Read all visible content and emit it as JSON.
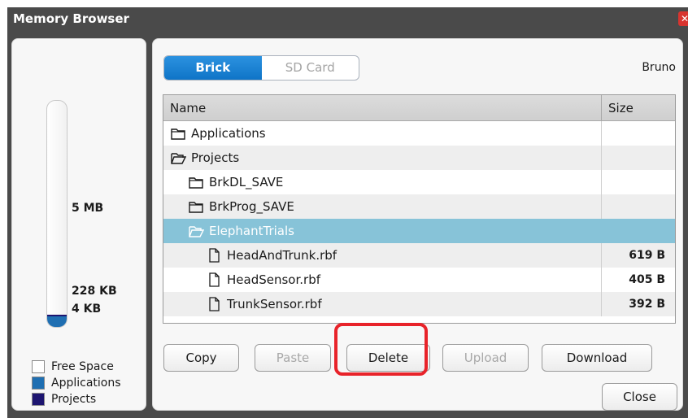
{
  "window": {
    "title": "Memory Browser"
  },
  "memory": {
    "label_total": "5 MB",
    "label_applications": "228 KB",
    "label_projects": "4 KB",
    "applications_fraction": 0.045,
    "projects_fraction": 0.001,
    "legend": [
      {
        "label": "Free Space",
        "color": "#ffffff"
      },
      {
        "label": "Applications",
        "color": "#1f6fb2"
      },
      {
        "label": "Projects",
        "color": "#1d1570"
      }
    ]
  },
  "tabs": [
    {
      "label": "Brick",
      "active": true
    },
    {
      "label": "SD Card",
      "active": false
    }
  ],
  "user": "Bruno",
  "table": {
    "headers": {
      "name": "Name",
      "size": "Size"
    },
    "rows": [
      {
        "name": "Applications",
        "size": "",
        "type": "folder-closed",
        "indent": 0,
        "selected": false
      },
      {
        "name": "Projects",
        "size": "",
        "type": "folder-open",
        "indent": 0,
        "selected": false
      },
      {
        "name": "BrkDL_SAVE",
        "size": "",
        "type": "folder-closed",
        "indent": 1,
        "selected": false
      },
      {
        "name": "BrkProg_SAVE",
        "size": "",
        "type": "folder-closed",
        "indent": 1,
        "selected": false
      },
      {
        "name": "ElephantTrials",
        "size": "",
        "type": "folder-open",
        "indent": 1,
        "selected": true
      },
      {
        "name": "HeadAndTrunk.rbf",
        "size": "619 B",
        "type": "file",
        "indent": 2,
        "selected": false
      },
      {
        "name": "HeadSensor.rbf",
        "size": "405 B",
        "type": "file",
        "indent": 2,
        "selected": false
      },
      {
        "name": "TrunkSensor.rbf",
        "size": "392 B",
        "type": "file",
        "indent": 2,
        "selected": false
      }
    ]
  },
  "buttons": {
    "copy": "Copy",
    "paste": "Paste",
    "delete": "Delete",
    "upload": "Upload",
    "download": "Download",
    "close": "Close"
  },
  "colors": {
    "accent": "#0f74c7",
    "selection": "#87c3d8",
    "highlight": "#e8232a"
  }
}
